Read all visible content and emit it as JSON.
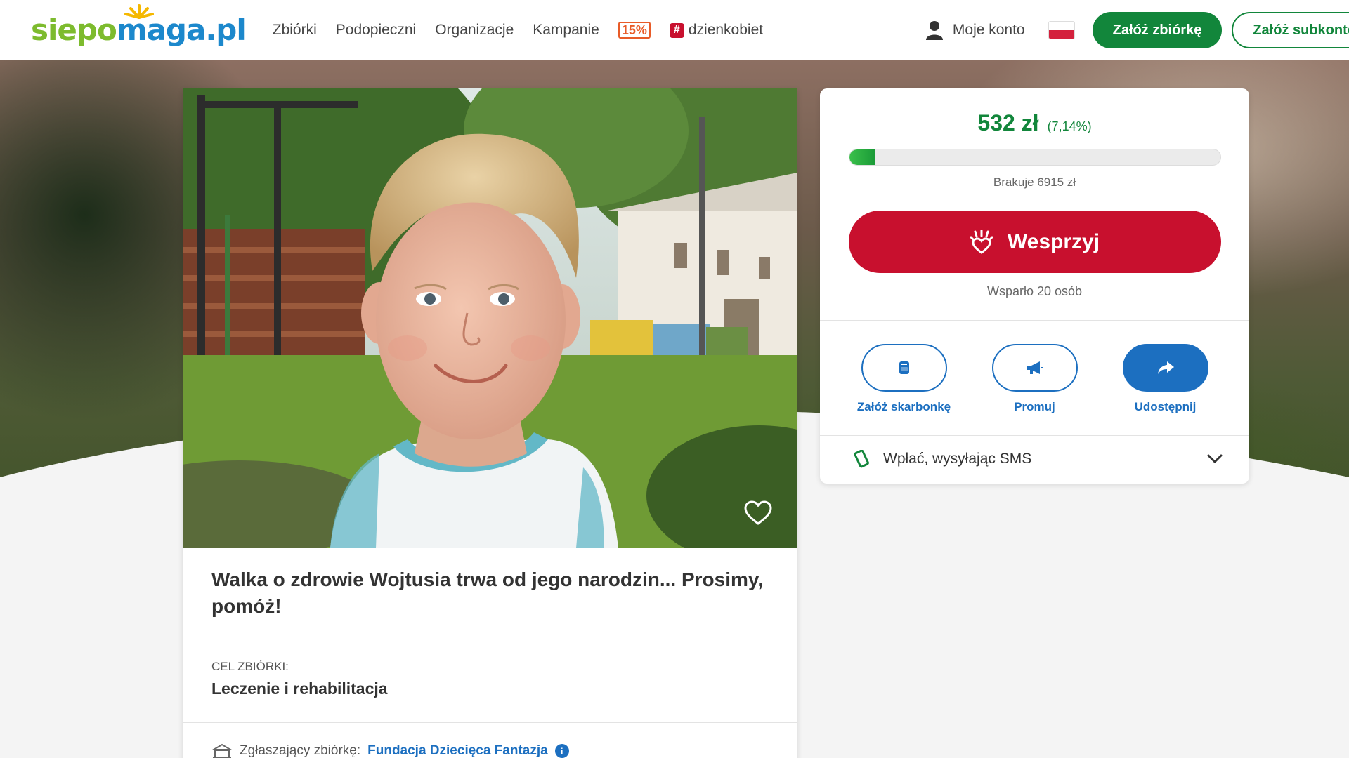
{
  "header": {
    "logo": {
      "part1": "siepo",
      "part2": "maga.pl"
    },
    "nav": [
      {
        "label": "Zbiórki"
      },
      {
        "label": "Podopieczni"
      },
      {
        "label": "Organizacje"
      },
      {
        "label": "Kampanie"
      }
    ],
    "badge_15": "15%",
    "hashtag": {
      "symbol": "#",
      "label": "dzienkobiet"
    },
    "account_label": "Moje konto",
    "create_fundraiser_label": "Załóż zbiórkę",
    "create_subaccount_label": "Załóż subkonto"
  },
  "campaign": {
    "title": "Walka o zdrowie Wojtusia trwa od jego narodzin... Prosimy, pomóż!",
    "goal_label": "CEL ZBIÓRKI:",
    "goal_value": "Leczenie i rehabilitacja",
    "org_prefix": "Zgłaszający zbiórkę:",
    "org_name": "Fundacja Dziecięca Fantazja",
    "org_info": "i"
  },
  "donation": {
    "amount": "532 zł",
    "percent": "(7,14%)",
    "progress_fraction": 0.0714,
    "missing": "Brakuje 6915 zł",
    "support_label": "Wesprzyj",
    "supporters": "Wsparło 20 osób",
    "actions": [
      {
        "label": "Załóż skarbonkę",
        "icon": "piggy-bank-icon"
      },
      {
        "label": "Promuj",
        "icon": "megaphone-icon"
      },
      {
        "label": "Udostępnij",
        "icon": "share-icon"
      }
    ],
    "sms_label": "Wpłać, wysyłając SMS"
  },
  "colors": {
    "brand_green": "#12863b",
    "brand_red": "#c8102e",
    "link_blue": "#1c6fc0",
    "logo_green": "#7dbb2e",
    "logo_blue": "#1c88cc"
  }
}
